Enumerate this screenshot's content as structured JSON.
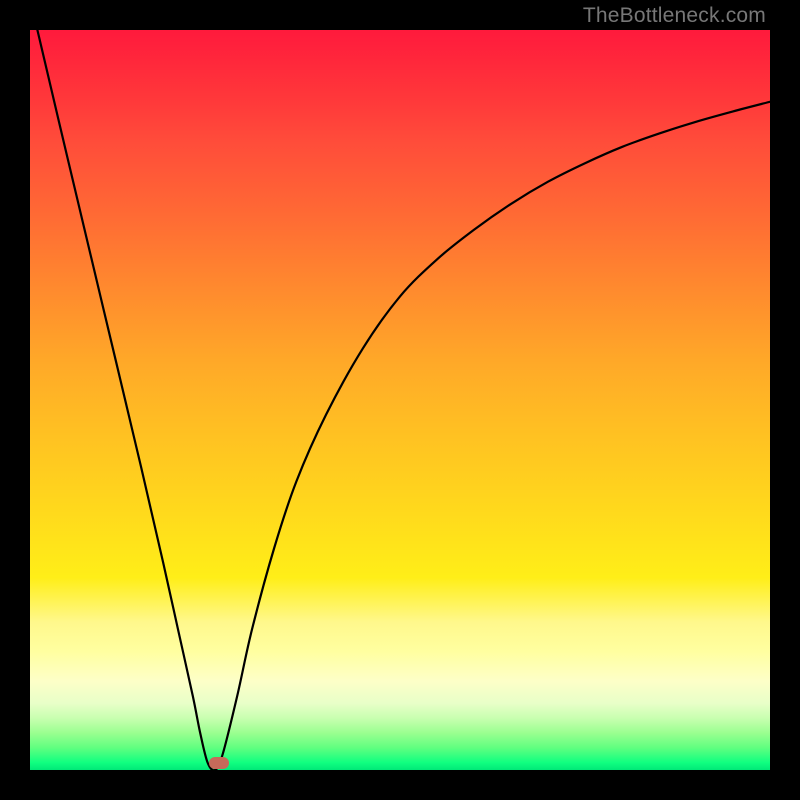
{
  "watermark": "TheBottleneck.com",
  "colors": {
    "page_bg": "#000000",
    "gradient_top": "#ff1a3c",
    "gradient_bottom": "#00e878",
    "curve": "#000000",
    "marker": "#c66a5a"
  },
  "chart_data": {
    "type": "line",
    "title": "",
    "xlabel": "",
    "ylabel": "",
    "xlim": [
      0,
      100
    ],
    "ylim": [
      0,
      100
    ],
    "x": [
      1,
      5,
      10,
      15,
      18,
      20,
      22,
      23,
      24,
      25,
      26,
      28,
      30,
      33,
      36,
      40,
      45,
      50,
      55,
      60,
      65,
      70,
      75,
      80,
      85,
      90,
      95,
      100
    ],
    "y": [
      100,
      83,
      62,
      41,
      28,
      19,
      10,
      5,
      1,
      0,
      2,
      10,
      19,
      30,
      39,
      48,
      57,
      64,
      69,
      73,
      76.5,
      79.5,
      82,
      84.2,
      86,
      87.6,
      89,
      90.3
    ],
    "minimum_x": 25,
    "minimum_y": 0,
    "marker": {
      "x": 25.5,
      "y": 1
    }
  }
}
